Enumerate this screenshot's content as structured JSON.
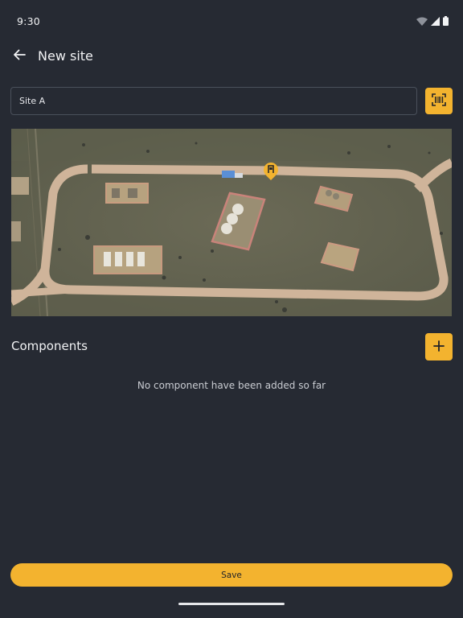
{
  "status_bar": {
    "time": "9:30",
    "icons": [
      "wifi-icon",
      "cell-signal-icon",
      "battery-icon"
    ]
  },
  "app_bar": {
    "back_icon": "arrow-left-icon",
    "title": "New site"
  },
  "site_form": {
    "name_value": "Site A",
    "scan_icon": "barcode-scan-icon"
  },
  "map": {
    "marker_icon": "location-pin-icon"
  },
  "components": {
    "title": "Components",
    "add_icon": "plus-icon",
    "empty_message": "No component have been added so far"
  },
  "actions": {
    "save_label": "Save"
  },
  "colors": {
    "background": "#262a33",
    "accent": "#f3b32f",
    "text": "#e9eaee"
  }
}
